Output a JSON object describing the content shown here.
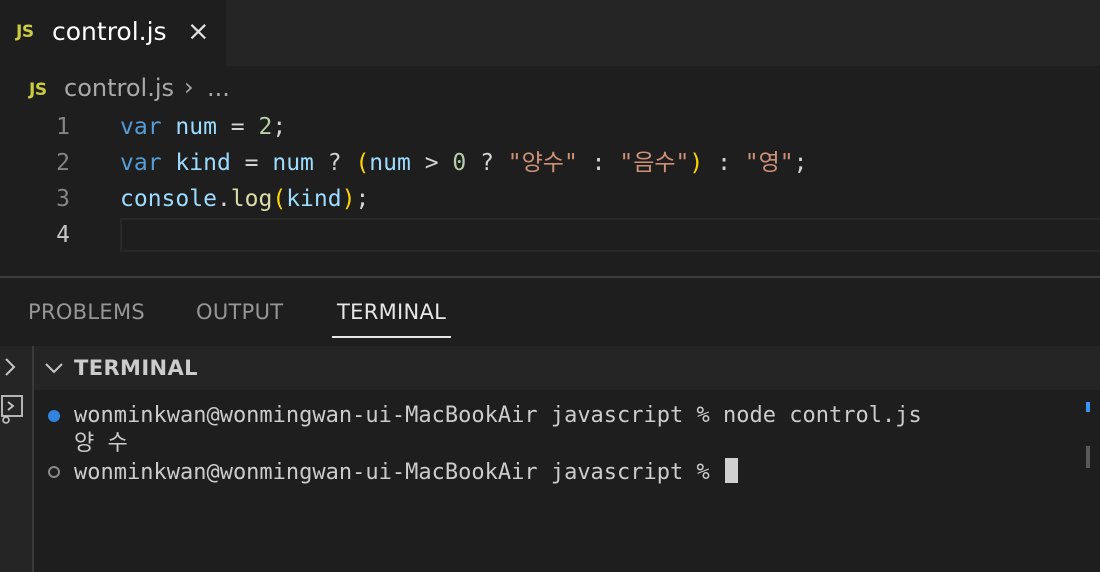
{
  "tab": {
    "badge": "JS",
    "title": "control.js",
    "close_glyph": "×"
  },
  "breadcrumb": {
    "badge": "JS",
    "file": "control.js",
    "separator": "›",
    "more": "..."
  },
  "editor": {
    "line_numbers": [
      "1",
      "2",
      "3",
      "4"
    ],
    "lines": [
      [
        {
          "t": "var",
          "c": "kw"
        },
        {
          "t": " ",
          "c": "op"
        },
        {
          "t": "num",
          "c": "var"
        },
        {
          "t": " = ",
          "c": "op"
        },
        {
          "t": "2",
          "c": "num"
        },
        {
          "t": ";",
          "c": "op"
        }
      ],
      [
        {
          "t": "var",
          "c": "kw"
        },
        {
          "t": " ",
          "c": "op"
        },
        {
          "t": "kind",
          "c": "var"
        },
        {
          "t": " = ",
          "c": "op"
        },
        {
          "t": "num",
          "c": "var"
        },
        {
          "t": " ? ",
          "c": "op"
        },
        {
          "t": "(",
          "c": "br1"
        },
        {
          "t": "num",
          "c": "var"
        },
        {
          "t": " > ",
          "c": "op"
        },
        {
          "t": "0",
          "c": "num"
        },
        {
          "t": " ? ",
          "c": "op"
        },
        {
          "t": "\"양수\"",
          "c": "str"
        },
        {
          "t": " : ",
          "c": "op"
        },
        {
          "t": "\"음수\"",
          "c": "str"
        },
        {
          "t": ")",
          "c": "br1"
        },
        {
          "t": " : ",
          "c": "op"
        },
        {
          "t": "\"영\"",
          "c": "str"
        },
        {
          "t": ";",
          "c": "op"
        }
      ],
      [
        {
          "t": "console",
          "c": "var"
        },
        {
          "t": ".",
          "c": "op"
        },
        {
          "t": "log",
          "c": "fn"
        },
        {
          "t": "(",
          "c": "br1"
        },
        {
          "t": "kind",
          "c": "var"
        },
        {
          "t": ")",
          "c": "br1"
        },
        {
          "t": ";",
          "c": "op"
        }
      ],
      []
    ]
  },
  "panel": {
    "tabs": [
      "PROBLEMS",
      "OUTPUT",
      "TERMINAL"
    ],
    "active_tab": "TERMINAL",
    "section_title": "TERMINAL"
  },
  "terminal": {
    "line1": "wonminkwan@wonmingwan-ui-MacBookAir javascript % node control.js",
    "line2": "양 수",
    "line3": "wonminkwan@wonmingwan-ui-MacBookAir javascript % "
  },
  "icons": {
    "close": "close-icon",
    "chevron_right": "chevron-right-icon",
    "chevron_down": "chevron-down-icon",
    "terminal_run": "terminal-run-icon"
  },
  "colors": {
    "js_badge": "#cbcb41",
    "keyword": "#569cd6",
    "variable": "#9cdcfe",
    "number": "#b5cea8",
    "string": "#ce9178",
    "function": "#dcdcaa",
    "bracket": "#ffd700",
    "success_dot": "#3794ff"
  }
}
